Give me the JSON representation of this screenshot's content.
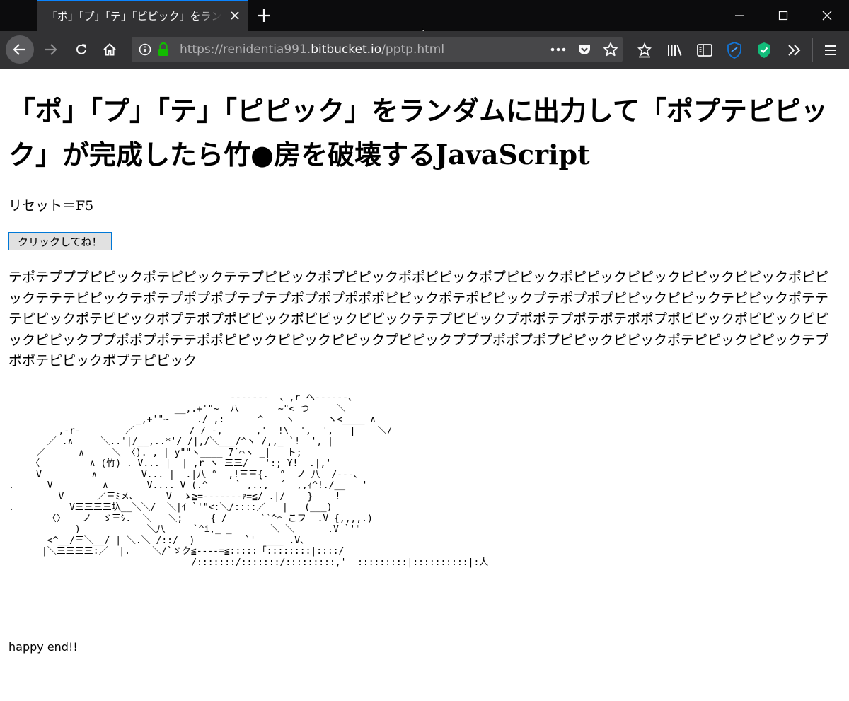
{
  "browser": {
    "tab_title": "「ポ」「プ」「テ」「ピピック」をランダムに出力して「ポプテピピック」が完成したら竹●房を破壊するJavaScript",
    "url_prefix": "https://renidentia991.",
    "url_host": "bitbucket.io",
    "url_path": "/pptp.html",
    "colors": {
      "tab_accent": "#0a84ff",
      "lock_green": "#12bc00",
      "toolbar": "#323234"
    },
    "icons": [
      "back-arrow-icon",
      "forward-arrow-icon",
      "reload-icon",
      "home-icon",
      "info-icon",
      "lock-icon",
      "more-dots-icon",
      "pocket-icon",
      "star-icon",
      "reader-icon",
      "library-icon",
      "sidebar-icon",
      "shield-icon",
      "shield-check-icon",
      "overflow-icon",
      "menu-icon"
    ]
  },
  "page": {
    "heading": "「ポ」「プ」「テ」「ピピック」をランダムに出力して「ポプテピピック」が完成したら竹●房を破壊するJavaScript",
    "reset_text": "リセット＝F5",
    "button_label": "クリックしてね！",
    "output": "テポテプププピピックポテピピックテテプピピックポプピピックポポピピックポプピピックポピピックピピックピピックピピックポピピックテテテピピックテポテプポプポプテプテプポプポプポポポピピックポテポピピックプテポプポプピピックピピックテピピックポテテテピピックポテピピックポプテポプポピピックポピピックピピックテテプピピックプポポテプポテポテポポプポピピックポピピックピピックピピックププポポプポテテポポピピックピピックピピックプピピックプププポポプポプピピックピピックポテピピックピピックテプポポテピピックポプテピピック",
    "ascii_art": "                                        -------  、,r ヘ------、\n                              __,.+'\"~  八       ~\"< つ     ＼\n                       _,+'\"~     ./ ,:      ^    ヽ      ヽ<____ ∧\n         ,-r-        ／          / / -,      ,'  !\\  ',  ',   |    ＼/\n       ／ .∧     ＼..'|/__,..*'/ /|,/＼___/^ヽ /,,_ `!  ', |\n     ／      ∧     ＼ 〈). , | y\"\"ヽ____ 7´⌒ヽ _|   ト;\n    〈         ∧ (竹) . V... |  | ,r ヽ 三三/   ':; Y!  .|,'\n     V         ∧        V... |  .|八 °  ,!三三{.  °  ノ 八  /---、\n.      V         ∧       V.... V (.^     ` ,..,  ´  ,,ｨ^!./__   '\n         V      ／三ﾐメ、     V  ゝ≧=-------ｧ=≦/ .|/    }    !\n.          V三三三三圦__＼＼/  ＼|ｲ `'\"<:＼/::::／   |   (___)\n       〈〉   ノ  ゞ三ｼ.  ＼   ＼;     { /      ``^⌒ こフ  .V {,,,,.)\n            )            ＼八     `^i,_ _       ＼ ＼      .V `'\"\n       <^__/三＼__/ | ＼.＼ /::/  )         `'  ___ .V、\n      |＼三三三三:／  |.    ＼/`ゞク≦----=≦:::::「::::::::|::::/\n                                 /:::::::/:::::::/:::::::::,'  :::::::::|::::::::::|:人",
    "footer_text": "happy end!!"
  }
}
